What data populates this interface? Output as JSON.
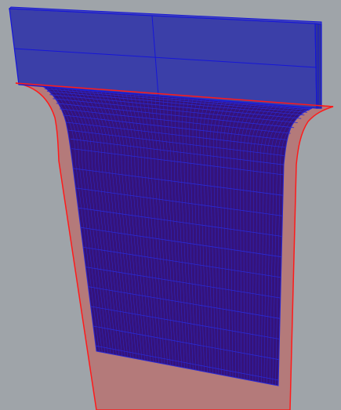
{
  "viewport": {
    "background_color": "#9fa4a9"
  },
  "model": {
    "outer_profile_fill": "#b47a7a",
    "outer_profile_stroke": "#ff1a1a",
    "mesh_fill": "#35137a",
    "mesh_line_color": "#2a2ad6",
    "block_fill": "#3b3fa8",
    "block_edge_color": "#1616d8"
  }
}
